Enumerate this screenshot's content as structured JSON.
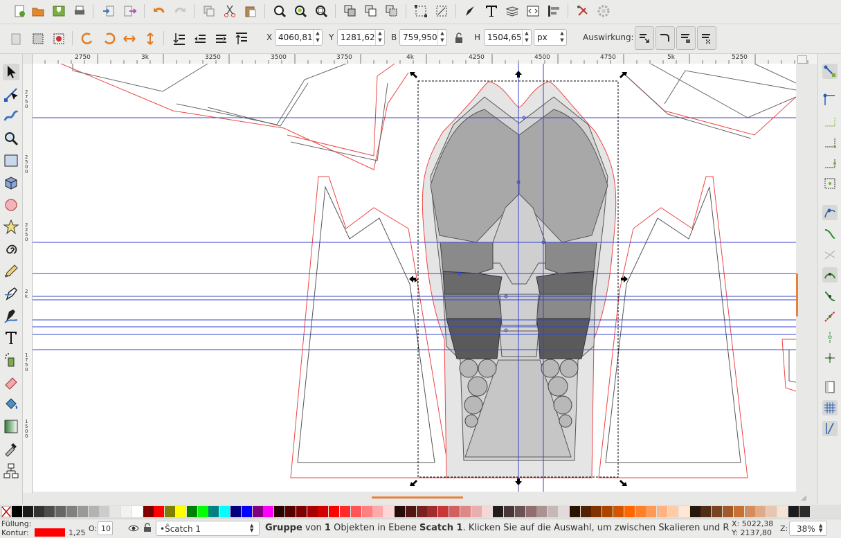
{
  "command_bar": {
    "icons": [
      "new-document-icon",
      "open-icon",
      "save-icon",
      "print-icon",
      "import-icon",
      "export-icon",
      "undo-icon",
      "redo-icon",
      "duplicate-icon",
      "cut-icon",
      "paste-icon",
      "zoom-selection-icon",
      "zoom-drawing-icon",
      "zoom-page-icon",
      "group-icon",
      "lock-icon",
      "layer-icon",
      "node-icon",
      "transform-icon",
      "fill-stroke-icon",
      "text-tool-icon",
      "layers-icon",
      "xml-editor-icon",
      "align-icon",
      "preferences-icon",
      "gear-icon"
    ]
  },
  "tool_controls": {
    "x_label": "X",
    "x_value": "4060,81",
    "y_label": "Y",
    "y_value": "1281,62",
    "w_label": "B",
    "w_value": "759,950",
    "h_label": "H",
    "h_value": "1504,65",
    "unit": "px",
    "affect_label": "Auswirkung:"
  },
  "ruler": {
    "h_ticks": [
      "2750",
      "3k",
      "3250",
      "3500",
      "3750",
      "4k",
      "4250",
      "4500",
      "4750",
      "5k",
      "5250"
    ],
    "v_ticks": [
      "2\n7\n5\n0",
      "2\n5\n0\n0",
      "2\n2\n5\n0",
      "2\nk",
      "1\n7\n5\n0",
      "1\n5\n0\n0"
    ]
  },
  "toolbox": {
    "tools": [
      "selector-tool-icon",
      "node-tool-icon",
      "tweak-tool-icon",
      "zoom-tool-icon",
      "rectangle-tool-icon",
      "box-3d-tool-icon",
      "ellipse-tool-icon",
      "star-tool-icon",
      "spiral-tool-icon",
      "pencil-tool-icon",
      "pen-tool-icon",
      "calligraphy-tool-icon",
      "text-tool-icon",
      "spray-tool-icon",
      "eraser-tool-icon",
      "paint-bucket-tool-icon",
      "gradient-tool-icon",
      "dropper-tool-icon",
      "connector-tool-icon"
    ]
  },
  "snap_controls": {
    "icons": [
      "snap-enable-icon",
      "snap-bbox-icon",
      "snap-bbox-edge-icon",
      "snap-bbox-corner-icon",
      "snap-bbox-midpoint-icon",
      "snap-bbox-center-icon",
      "snap-nodes-icon",
      "snap-path-icon",
      "snap-intersection-icon",
      "snap-smooth-icon",
      "snap-midpoint-icon",
      "snap-object-midpoint-icon",
      "snap-center-icon",
      "snap-rotation-center-icon",
      "snap-page-icon",
      "snap-grid-icon",
      "snap-guide-icon"
    ]
  },
  "palette": {
    "colors": [
      "#000000",
      "#1a1a1a",
      "#333333",
      "#4d4d4d",
      "#666666",
      "#808080",
      "#999999",
      "#b3b3b3",
      "#cccccc",
      "#e6e6e6",
      "#f2f2f2",
      "#ffffff",
      "#800000",
      "#ff0000",
      "#808000",
      "#ffff00",
      "#008000",
      "#00ff00",
      "#008080",
      "#00ffff",
      "#000080",
      "#0000ff",
      "#800080",
      "#ff00ff",
      "#2b0000",
      "#550000",
      "#800000",
      "#aa0000",
      "#d40000",
      "#ff0000",
      "#ff2a2a",
      "#ff5555",
      "#ff8080",
      "#ffaaaa",
      "#ffd5d5",
      "#280b0b",
      "#501616",
      "#782121",
      "#a02c2c",
      "#c83737",
      "#d35f5f",
      "#de8787",
      "#e9afaf",
      "#f4d7d7",
      "#241c1c",
      "#483737",
      "#6c5353",
      "#916f6f",
      "#ac9393",
      "#c8b7b7",
      "#e3dbdb",
      "#2b1100",
      "#552200",
      "#803300",
      "#aa4400",
      "#d45500",
      "#ff6600",
      "#ff7f2a",
      "#ff9955",
      "#ffb380",
      "#ffccaa",
      "#ffe6d5",
      "#28170b",
      "#502d16",
      "#784421",
      "#a05a2c",
      "#c87137",
      "#d38d5f",
      "#deaa87",
      "#e9c6af",
      "#f4e3d7",
      "#1c1a1c",
      "#2b2b2b"
    ]
  },
  "status": {
    "fill_label": "Füllung:",
    "stroke_label": "Kontur:",
    "stroke_color": "#ff0000",
    "stroke_width": "1,25",
    "opacity_label": "O:",
    "opacity_value": "10",
    "layer_name": "•Ŝcatch 1",
    "message_bold1": "Gruppe",
    "message_t1": " von ",
    "message_bold2": "1",
    "message_t2": " Objekten in Ebene ",
    "message_bold3": "Ŝcatch 1",
    "message_t3": ". Klicken Sie auf die Auswahl, um zwischen Skalieren und R…",
    "cursor_x": "X: 5022,38",
    "cursor_y": "Y: 2137,80",
    "zoom_label": "Z:",
    "zoom_value": "38%"
  }
}
